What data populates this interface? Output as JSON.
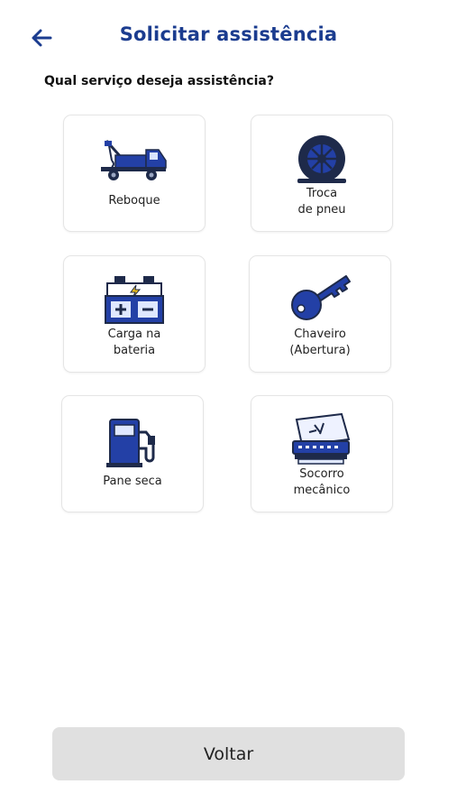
{
  "header": {
    "title": "Solicitar assistência",
    "back_icon": "arrow-left-icon"
  },
  "question": "Qual serviço deseja assistência?",
  "services": [
    {
      "lines": [
        "Reboque"
      ],
      "icon": "tow-truck-icon"
    },
    {
      "lines": [
        "Troca",
        "de pneu"
      ],
      "icon": "tire-icon"
    },
    {
      "lines": [
        "Carga na",
        "bateria"
      ],
      "icon": "battery-icon"
    },
    {
      "lines": [
        "Chaveiro",
        "(Abertura)"
      ],
      "icon": "key-icon"
    },
    {
      "lines": [
        "Pane seca"
      ],
      "icon": "fuel-pump-icon"
    },
    {
      "lines": [
        "Socorro",
        "mecânico"
      ],
      "icon": "mechanic-icon"
    }
  ],
  "footer": {
    "back_button": "Voltar"
  },
  "colors": {
    "accent": "#1b3c8f",
    "icon_blue": "#2340a6",
    "button_bg": "#e0e0e0"
  }
}
